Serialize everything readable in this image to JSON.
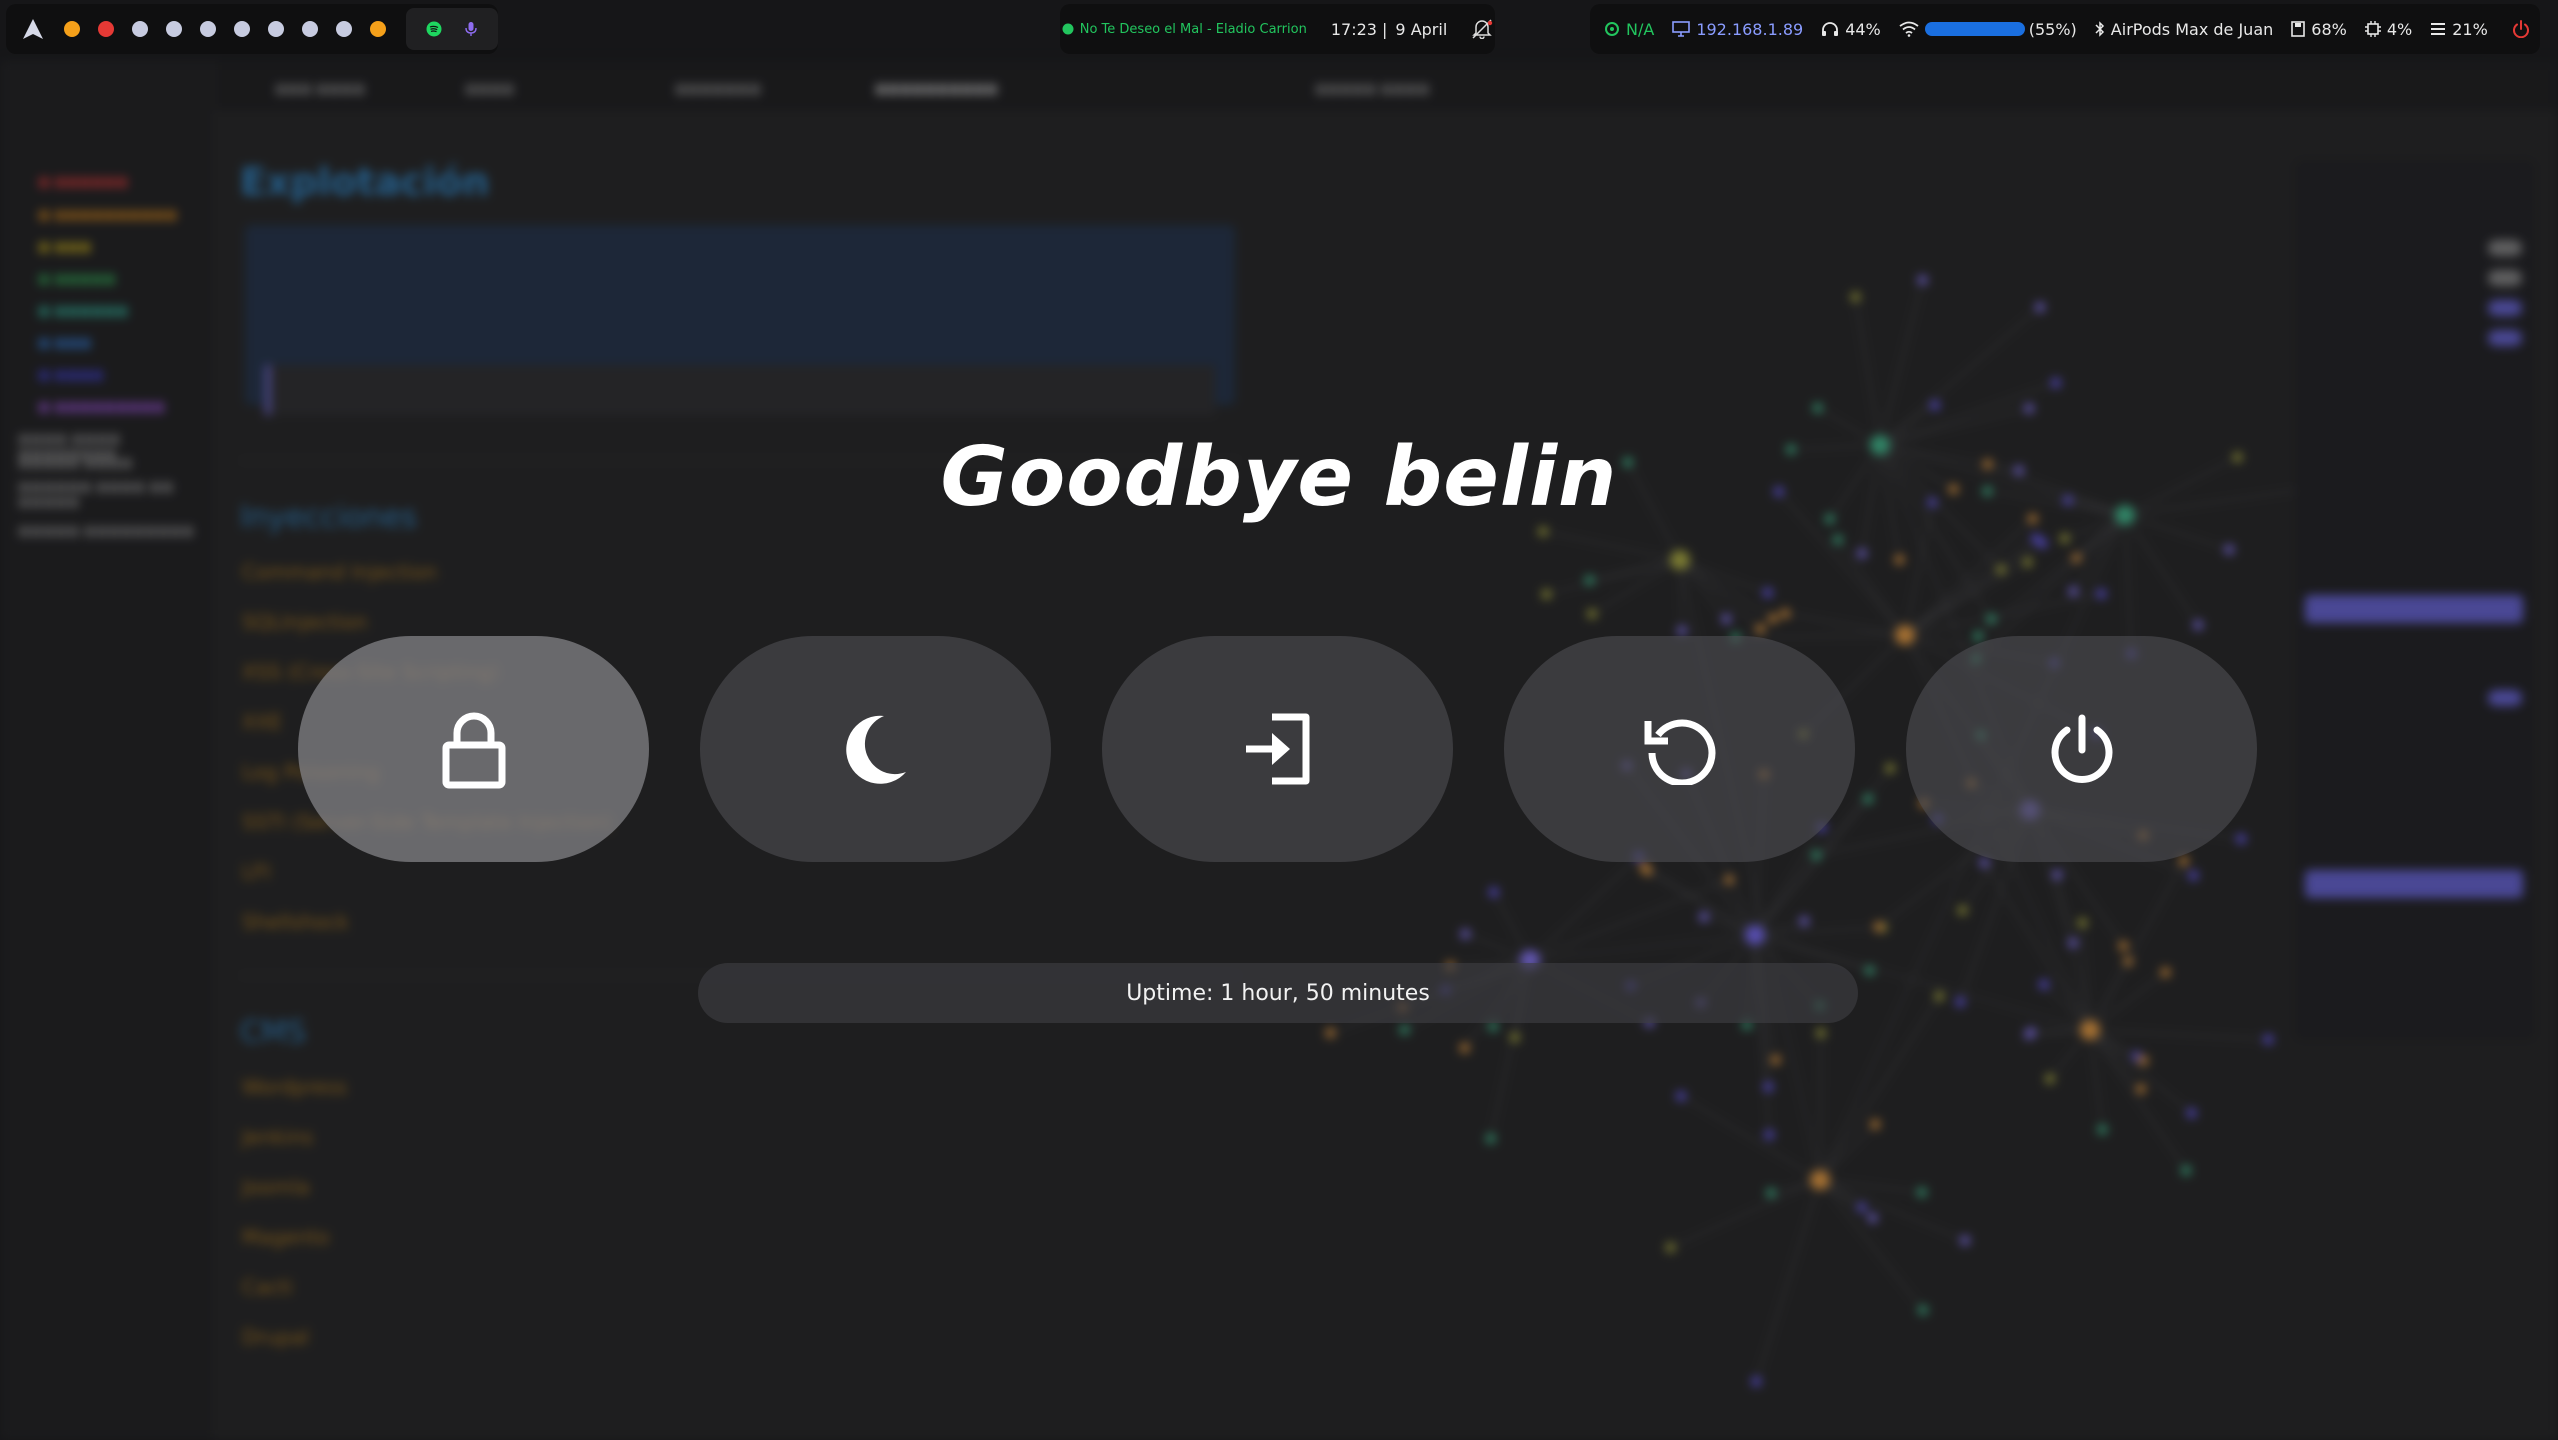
{
  "topbar": {
    "workspace_dot_colors": [
      "#f5a01a",
      "#e53935",
      "#c7cbe0",
      "#c7cbe0",
      "#c7cbe0",
      "#c7cbe0",
      "#c7cbe0",
      "#c7cbe0",
      "#c7cbe0",
      "#f5a01a"
    ],
    "tray_icons": [
      "spotify-icon",
      "mic-icon"
    ],
    "now_playing": "No Te Deseo el Mal - Eladio Carrion",
    "time": "17:23 |",
    "date": "9 April",
    "vpn": "N/A",
    "ip": "192.168.1.89",
    "volume": "44%",
    "wifi_signal": "(55%)",
    "bluetooth_device": "AirPods Max de Juan",
    "disk": "68%",
    "cpu": "4%",
    "memory": "21%",
    "colors": {
      "green": "#22c55e",
      "blue": "#8a9cff",
      "red": "#e53935"
    }
  },
  "background_app": {
    "note_title": "Explotación",
    "sections": [
      "Inyecciones",
      "CMS"
    ],
    "injection_items": [
      "Command Injection",
      "SQLInjection",
      "XSS (Cross-Site Scripting)",
      "XXE",
      "Log Poisoning",
      "SSTI (Server-Side Template Injection)",
      "LFI",
      "Shellshock"
    ],
    "cms_items": [
      "Wordpress",
      "Jenkins",
      "Joomla",
      "Magento",
      "Cacti",
      "Drupal"
    ]
  },
  "session_menu": {
    "title": "Goodbye belin",
    "actions": [
      {
        "name": "lock",
        "icon": "lock-icon",
        "selected": true
      },
      {
        "name": "suspend",
        "icon": "moon-icon",
        "selected": false
      },
      {
        "name": "logout",
        "icon": "logout-icon",
        "selected": false
      },
      {
        "name": "reboot",
        "icon": "reboot-icon",
        "selected": false
      },
      {
        "name": "shutdown",
        "icon": "power-icon",
        "selected": false
      }
    ],
    "uptime": "Uptime: 1 hour, 50 minutes"
  }
}
